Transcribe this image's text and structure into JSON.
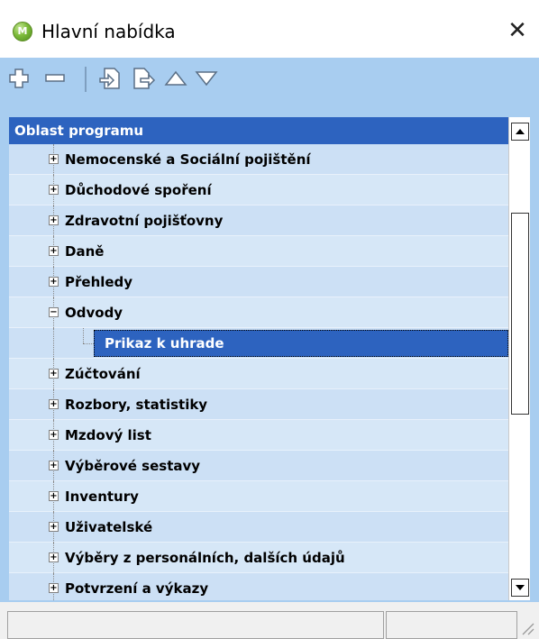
{
  "window": {
    "title": "Hlavní nabídka",
    "app_icon_letter": "M",
    "close_glyph": "✕"
  },
  "toolbar": {
    "buttons": [
      {
        "icon": "add-icon"
      },
      {
        "icon": "remove-icon"
      },
      {
        "icon": "import-icon"
      },
      {
        "icon": "export-icon"
      },
      {
        "icon": "move-up-icon"
      },
      {
        "icon": "move-down-icon"
      }
    ]
  },
  "tree": {
    "header": "Oblast programu",
    "items": [
      {
        "label": "Nemocenské a Sociální pojištění",
        "toggle": "+"
      },
      {
        "label": "Důchodové spoření",
        "toggle": "+"
      },
      {
        "label": "Zdravotní pojišťovny",
        "toggle": "+"
      },
      {
        "label": "Daně",
        "toggle": "+"
      },
      {
        "label": "Přehledy",
        "toggle": "+"
      },
      {
        "label": "Odvody",
        "toggle": "−"
      },
      {
        "label": "Prikaz k uhrade",
        "selected": true
      },
      {
        "label": "Zúčtování",
        "toggle": "+"
      },
      {
        "label": "Rozbory, statistiky",
        "toggle": "+"
      },
      {
        "label": "Mzdový list",
        "toggle": "+"
      },
      {
        "label": "Výběrové sestavy",
        "toggle": "+"
      },
      {
        "label": "Inventury",
        "toggle": "+"
      },
      {
        "label": "Uživatelské",
        "toggle": "+"
      },
      {
        "label": "Výběry z personálních, dalších údajů",
        "toggle": "+"
      },
      {
        "label": "Potvrzení a výkazy",
        "toggle": "+"
      }
    ]
  },
  "colors": {
    "toolbar_bg": "#a8cdf0",
    "header_bg": "#2d63bf",
    "row_bg": "#cce0f5"
  }
}
